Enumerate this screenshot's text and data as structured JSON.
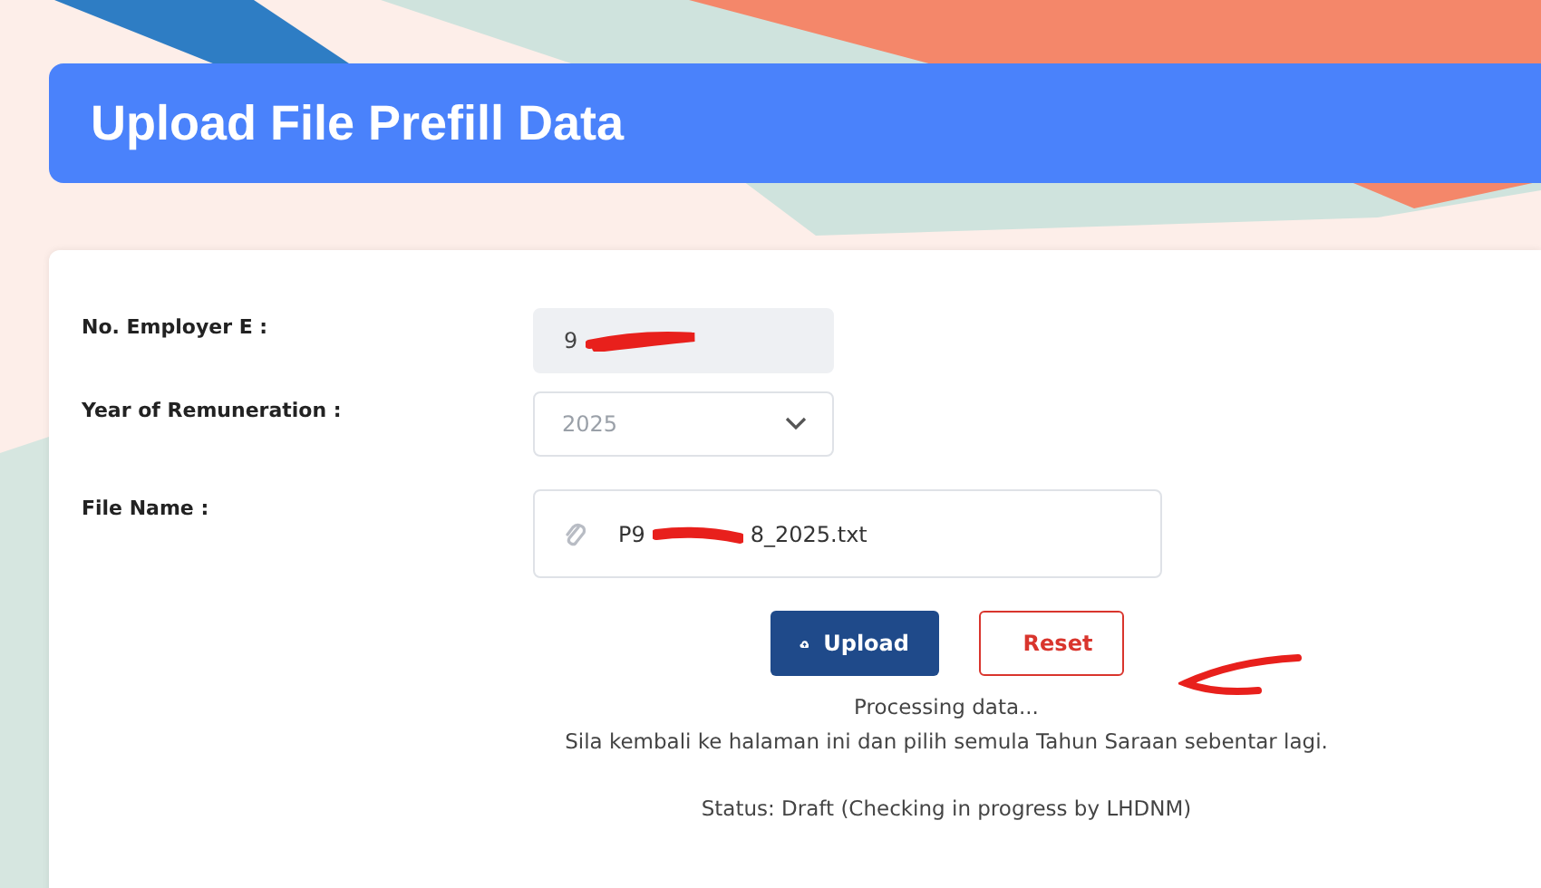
{
  "page_title": "Upload File Prefill Data",
  "form": {
    "employer_label": "No. Employer E :",
    "employer_value": "9",
    "year_label": "Year of Remuneration :",
    "year_value": "2025",
    "file_label": "File Name :",
    "file_name_start": "P9",
    "file_name_end": "8_2025.txt"
  },
  "buttons": [
    {
      "kind": "primary",
      "label": "Upload"
    },
    {
      "kind": "danger",
      "label": "Reset"
    }
  ],
  "messages": [
    "Processing data...",
    "Sila kembali ke halaman ini dan pilih semula Tahun Saraan sebentar lagi."
  ],
  "status": "Status: Draft (Checking in progress by LHDNM)"
}
